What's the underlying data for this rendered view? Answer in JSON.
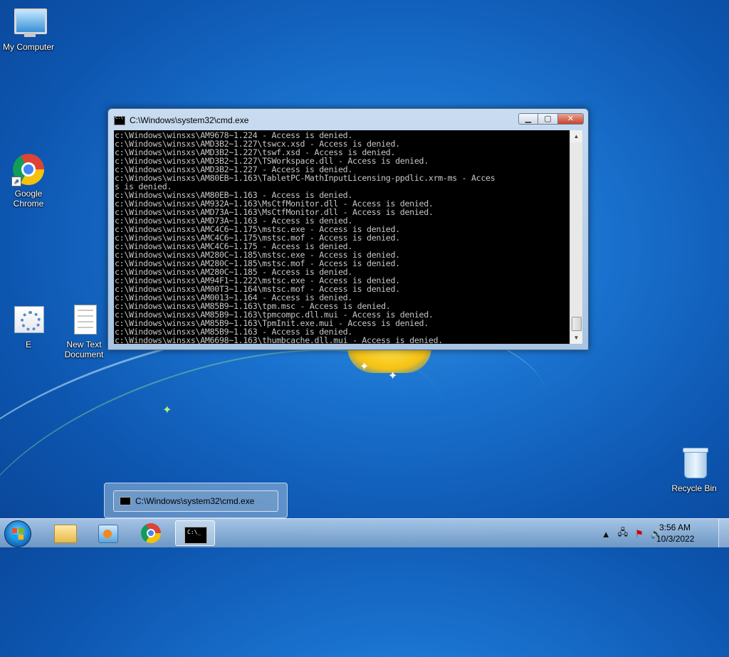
{
  "desktop": {
    "icons": [
      {
        "id": "my-computer",
        "label": "My Computer"
      },
      {
        "id": "google-chrome",
        "label": "Google Chrome"
      },
      {
        "id": "e-file",
        "label": "E"
      },
      {
        "id": "new-text-document",
        "label": "New Text Document"
      },
      {
        "id": "recycle-bin",
        "label": "Recycle Bin"
      }
    ]
  },
  "cmd": {
    "title": "C:\\Windows\\system32\\cmd.exe",
    "lines": [
      "c:\\Windows\\winsxs\\AM9678~1.224 - Access is denied.",
      "c:\\Windows\\winsxs\\AMD3B2~1.227\\tswcx.xsd - Access is denied.",
      "c:\\Windows\\winsxs\\AMD3B2~1.227\\tswf.xsd - Access is denied.",
      "c:\\Windows\\winsxs\\AMD3B2~1.227\\TSWorkspace.dll - Access is denied.",
      "c:\\Windows\\winsxs\\AMD3B2~1.227 - Access is denied.",
      "c:\\Windows\\winsxs\\AM80EB~1.163\\TabletPC-MathInputLicensing-ppdlic.xrm-ms - Acces",
      "s is denied.",
      "c:\\Windows\\winsxs\\AM80EB~1.163 - Access is denied.",
      "c:\\Windows\\winsxs\\AM932A~1.163\\MsCtfMonitor.dll - Access is denied.",
      "c:\\Windows\\winsxs\\AMD73A~1.163\\MsCtfMonitor.dll - Access is denied.",
      "c:\\Windows\\winsxs\\AMD73A~1.163 - Access is denied.",
      "c:\\Windows\\winsxs\\AMC4C6~1.175\\mstsc.exe - Access is denied.",
      "c:\\Windows\\winsxs\\AMC4C6~1.175\\mstsc.mof - Access is denied.",
      "c:\\Windows\\winsxs\\AMC4C6~1.175 - Access is denied.",
      "c:\\Windows\\winsxs\\AM280C~1.185\\mstsc.exe - Access is denied.",
      "c:\\Windows\\winsxs\\AM280C~1.185\\mstsc.mof - Access is denied.",
      "c:\\Windows\\winsxs\\AM280C~1.185 - Access is denied.",
      "c:\\Windows\\winsxs\\AM94F1~1.222\\mstsc.exe - Access is denied.",
      "c:\\Windows\\winsxs\\AM00T3~1.164\\mstsc.mof - Access is denied.",
      "c:\\Windows\\winsxs\\AM0013~1.164 - Access is denied.",
      "c:\\Windows\\winsxs\\AM85B9~1.163\\tpm.msc - Access is denied.",
      "c:\\Windows\\winsxs\\AM85B9~1.163\\tpmcompc.dll.mui - Access is denied.",
      "c:\\Windows\\winsxs\\AM85B9~1.163\\TpmInit.exe.mui - Access is denied.",
      "c:\\Windows\\winsxs\\AM85B9~1.163 - Access is denied.",
      "c:\\Windows\\winsxs\\AM6698~1.163\\thumbcache.dll.mui - Access is denied."
    ]
  },
  "preview": {
    "title": "C:\\Windows\\system32\\cmd.exe"
  },
  "taskbar": {
    "clock_time": "3:56 AM",
    "clock_date": "10/3/2022"
  }
}
